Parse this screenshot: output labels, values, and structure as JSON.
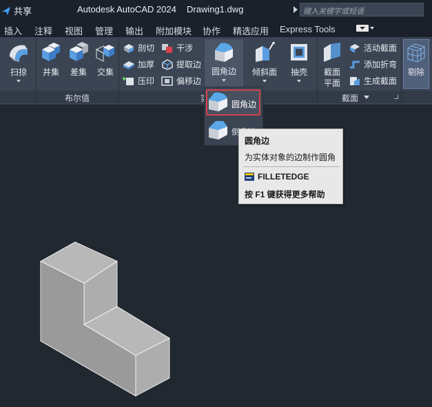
{
  "titlebar": {
    "share_label": "共享",
    "app_title": "Autodesk AutoCAD 2024",
    "doc_title": "Drawing1.dwg",
    "search_placeholder": "键入关键字或短语"
  },
  "menu": {
    "items": [
      "插入",
      "注释",
      "视图",
      "管理",
      "输出",
      "附加模块",
      "协作",
      "精选应用",
      "Express Tools"
    ]
  },
  "ribbon": {
    "sweep": "扫掠",
    "union": "并集",
    "subtract": "差集",
    "intersect": "交集",
    "boolean_panel": "布尔值",
    "slice": "剖切",
    "interfere": "干涉",
    "thicken": "加厚",
    "extract_edges": "提取边",
    "imprint": "压印",
    "offset_edge": "偏移边",
    "solid_panel_partial": "实",
    "fillet_edge": "圆角边",
    "taper_faces": "倾斜面",
    "shell": "抽壳",
    "section_plane_1": "截面",
    "section_plane_2": "平面",
    "live_section": "活动截面",
    "add_jog": "添加折弯",
    "generate_section": "生成截面",
    "section_panel": "截面",
    "cull": "剔除"
  },
  "dropdown": {
    "item1": "圆角边",
    "item2": "倒角边"
  },
  "tooltip": {
    "title": "圆角边",
    "description": "为实体对象的边制作圆角",
    "command": "FILLETEDGE",
    "help": "按 F1 键获得更多帮助"
  },
  "colors": {
    "background": "#212830",
    "ribbon": "#3b4453",
    "highlight_border": "#d9414b",
    "tooltip_bg": "#e8e8e8",
    "solid_top": "#b8b8b8",
    "solid_left": "#9a9a9a",
    "solid_front": "#adadad"
  }
}
